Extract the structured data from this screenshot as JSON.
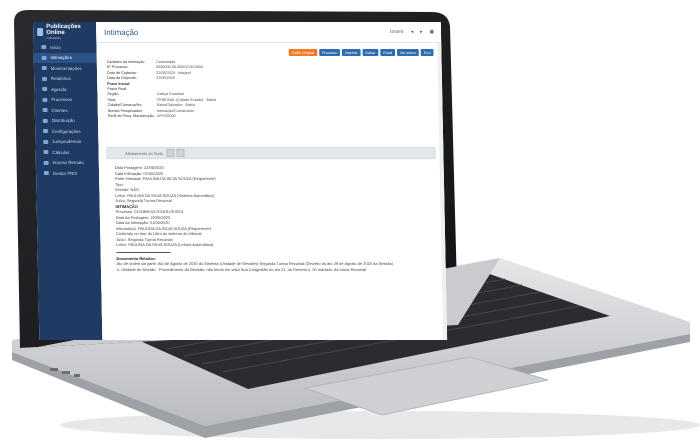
{
  "app": {
    "brand": "Publicações Online",
    "brand_sub": "Intimações"
  },
  "sidebar": {
    "items": [
      {
        "label": "Início"
      },
      {
        "label": "Intimações",
        "active": true
      },
      {
        "label": "Movimentações"
      },
      {
        "label": "Relatórios"
      },
      {
        "label": "Agenda"
      },
      {
        "label": "Processos"
      },
      {
        "label": "Clientes"
      },
      {
        "label": "Distribuição"
      },
      {
        "label": "Configurações"
      },
      {
        "label": "Jurisprudência"
      },
      {
        "label": "Cálculos"
      },
      {
        "label": "Acesso Remoto"
      },
      {
        "label": "Gestor PRO"
      }
    ]
  },
  "header": {
    "title": "Intimação",
    "top_action": "Inserir"
  },
  "actions": [
    {
      "label": "Exibir Original",
      "color": "#ef7b2a"
    },
    {
      "label": "Processo",
      "color": "#2f6db2"
    },
    {
      "label": "Imprimir",
      "color": "#2f6db2"
    },
    {
      "label": "Salvar",
      "color": "#2f6db2"
    },
    {
      "label": "Email",
      "color": "#2f6db2"
    },
    {
      "label": "Ver anexo",
      "color": "#2f6db2"
    },
    {
      "label": "Excl",
      "color": "#2f6db2"
    }
  ],
  "fields": [
    {
      "k": "Cadastro da Intimação:",
      "v": "Cadastrada"
    },
    {
      "k": "Nº Processo:",
      "v": "0000000-00.0000.0.00.0000"
    },
    {
      "k": "Data de Cadastro:",
      "v": "22/06/2020 · Integral"
    },
    {
      "k": "Data da Disponib.:",
      "v": "22/06/2020"
    },
    {
      "k": "Prazo Inicial:",
      "v": "",
      "bold": true
    },
    {
      "k": "Prazo Final:",
      "v": ""
    },
    {
      "k": "Órgão:",
      "v": "Justiça Estadual"
    },
    {
      "k": "Vara:",
      "v": "TRIBUNAL (Cidade-Estado) - Bahia"
    },
    {
      "k": "Cidade/Comarca/Hs:",
      "v": "Bahia/Salvador - Bahia"
    },
    {
      "k": "Nomes Pesquisados:",
      "v": "Intimação/Comarcada"
    },
    {
      "k": "Perfil de Pesq. Manutenção:",
      "v": "APVSS000"
    }
  ],
  "tab": {
    "label": "Alinhamento do Texto"
  },
  "body_text": [
    {
      "t": "Data Postagem: 22/06/2020"
    },
    {
      "t": "Data Intimação: 01/06/2020"
    },
    {
      "t": "Parte Intimada: PAULINA DA SILVA SOUZA (Requerente)"
    },
    {
      "t": "Tipo:"
    },
    {
      "t": "Sessão: NÃO"
    },
    {
      "t": "Leitor: PAULINA DA SILVA SOUZA (Sistema Automático)"
    },
    {
      "t": "Juízo: Segunda Turma Recursal"
    },
    {
      "t": "INTIMAÇÃO",
      "bold": true
    },
    {
      "t": "Processo: 0101868-53.2019.8.05.0001"
    },
    {
      "t": "Data da Postagem: 22/06/2020"
    },
    {
      "t": "Data da Intimação: 01/06/2020"
    },
    {
      "t": "Intimado(a): PAULINA DA SILVA SOUZA (Requerente)"
    },
    {
      "t": "Conteúdo no teor do Libro do sistema do tribunal"
    },
    {
      "t": "Juízo: Segunda Turma Recursal"
    },
    {
      "t": "Leitor: PAULINA DA SILVA SOUZA (Leitura Automática)"
    },
    {
      "t": "divider"
    },
    {
      "t": "Documento Relativo:",
      "bold": true
    },
    {
      "t": "Ato de ordem da parte: Ato de Agosto de 2020 do Sistema (Unidade de Sessões) Segunda Turma Recursal (Decreto do ato 29 de Agosto de 2020 da Sessão)"
    },
    {
      "t": "n. Unidade de Sessão · Procedimento da Decisão: não tendo em vista Sua Congestão do ato 21, do Decreto n. 20 mantido, da turma Recursal"
    }
  ]
}
